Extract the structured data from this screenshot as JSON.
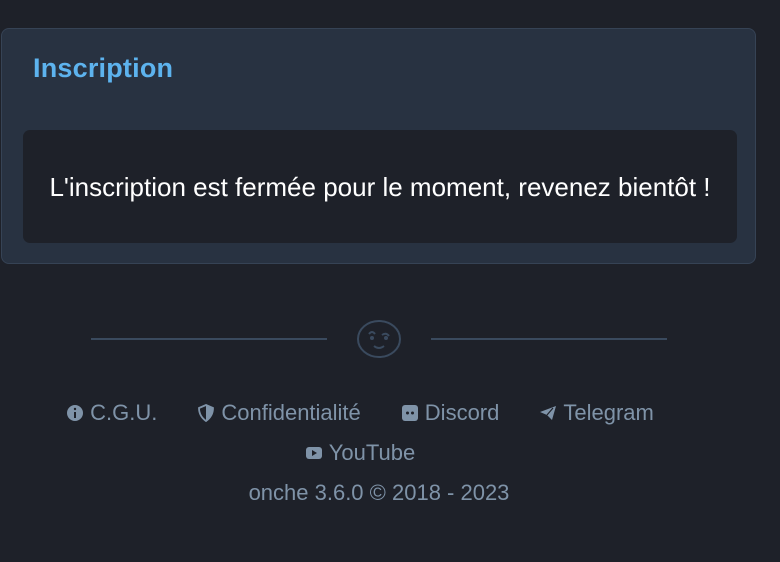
{
  "card": {
    "title": "Inscription",
    "message": "L'inscription est fermée pour le moment, revenez bientôt !"
  },
  "footer": {
    "links": [
      {
        "label": "C.G.U.",
        "icon": "info-icon"
      },
      {
        "label": "Confidentialité",
        "icon": "shield-icon"
      },
      {
        "label": "Discord",
        "icon": "discord-icon"
      },
      {
        "label": "Telegram",
        "icon": "telegram-icon"
      },
      {
        "label": "YouTube",
        "icon": "youtube-icon"
      }
    ],
    "copyright": "onche 3.6.0 © 2018 - 2023"
  },
  "colors": {
    "background": "#1e2129",
    "card": "#283241",
    "accent": "#5db3ee",
    "muted": "#7f93a8"
  }
}
